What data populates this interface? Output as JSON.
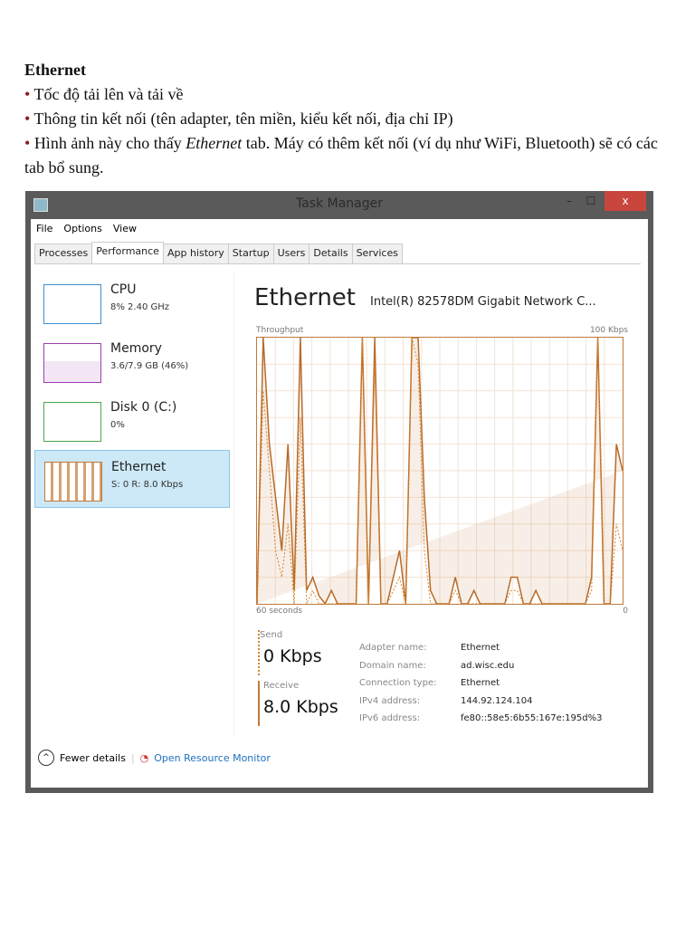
{
  "doc": {
    "heading": "Ethernet",
    "bullet": "•",
    "items": [
      "Tốc độ tải lên và tải về",
      "Thông tin kết nối (tên adapter, tên miền, kiểu kết nối, địa chỉ IP)"
    ],
    "item3_pre": "Hình ảnh này cho thấy ",
    "item3_em": "Ethernet",
    "item3_post": " tab. Máy có thêm kết nối (ví dụ như WiFi, Bluetooth) sẽ có các tab bổ sung."
  },
  "window": {
    "title": "Task Manager",
    "minimize": "–",
    "maximize": "☐",
    "close": "x",
    "menu": [
      "File",
      "Options",
      "View"
    ],
    "tabs": [
      "Processes",
      "Performance",
      "App history",
      "Startup",
      "Users",
      "Details",
      "Services"
    ],
    "sidebar": [
      {
        "name": "CPU",
        "value": "8% 2.40 GHz",
        "color": "#3c8fd1"
      },
      {
        "name": "Memory",
        "value": "3.6/7.9 GB (46%)",
        "color": "#9b3fb0"
      },
      {
        "name": "Disk 0 (C:)",
        "value": "0%",
        "color": "#4da64d"
      },
      {
        "name": "Ethernet",
        "value": "S: 0 R: 8.0 Kbps",
        "color": "#c07a3a"
      }
    ],
    "main": {
      "title": "Ethernet",
      "adapter": "Intel(R) 82578DM Gigabit Network C...",
      "throughput": "Throughput",
      "max": "100 Kbps",
      "time": "60 seconds",
      "zero": "0",
      "send_label": "Send",
      "send_value": "0 Kbps",
      "receive_label": "Receive",
      "receive_value": "8.0 Kbps",
      "info": [
        {
          "k": "Adapter name:",
          "v": "Ethernet"
        },
        {
          "k": "Domain name:",
          "v": "ad.wisc.edu"
        },
        {
          "k": "Connection type:",
          "v": "Ethernet"
        },
        {
          "k": "IPv4 address:",
          "v": "144.92.124.104"
        },
        {
          "k": "IPv6 address:",
          "v": "fe80::58e5:6b55:167e:195d%3"
        }
      ]
    },
    "footer": {
      "fewer": "Fewer details",
      "monitor": "Open Resource Monitor"
    }
  },
  "chart_data": {
    "type": "line",
    "ylim": [
      0,
      100
    ],
    "ylabel": "Kbps",
    "xlabel": "60 seconds",
    "series": [
      {
        "name": "Receive",
        "values": [
          0,
          100,
          60,
          40,
          20,
          60,
          5,
          100,
          5,
          10,
          3,
          0,
          5,
          0,
          0,
          0,
          0,
          100,
          0,
          100,
          0,
          0,
          10,
          20,
          0,
          100,
          100,
          40,
          5,
          0,
          0,
          0,
          10,
          0,
          0,
          5,
          0,
          0,
          0,
          0,
          0,
          10,
          10,
          0,
          0,
          5,
          0,
          0,
          0,
          0,
          0,
          0,
          0,
          0,
          10,
          100,
          0,
          0,
          60,
          50
        ]
      },
      {
        "name": "Send",
        "values": [
          0,
          80,
          50,
          20,
          10,
          30,
          0,
          70,
          0,
          5,
          0,
          0,
          0,
          0,
          0,
          0,
          0,
          100,
          0,
          90,
          0,
          0,
          5,
          10,
          0,
          100,
          90,
          20,
          0,
          0,
          0,
          0,
          5,
          0,
          0,
          0,
          0,
          0,
          0,
          0,
          0,
          5,
          5,
          0,
          0,
          0,
          0,
          0,
          0,
          0,
          0,
          0,
          0,
          0,
          5,
          100,
          0,
          0,
          30,
          20
        ]
      }
    ]
  }
}
